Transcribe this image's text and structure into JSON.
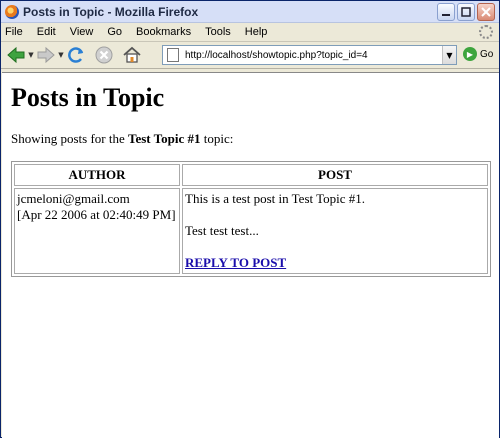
{
  "window": {
    "title": "Posts in Topic - Mozilla Firefox"
  },
  "menubar": {
    "items": [
      "File",
      "Edit",
      "View",
      "Go",
      "Bookmarks",
      "Tools",
      "Help"
    ]
  },
  "navbar": {
    "url": "http://localhost/showtopic.php?topic_id=4",
    "go_label": "Go"
  },
  "page": {
    "title": "Posts in Topic",
    "intro_prefix": "Showing posts for the ",
    "topic_name": "Test Topic #1",
    "intro_suffix": " topic:",
    "table": {
      "headers": [
        "AUTHOR",
        "POST"
      ],
      "rows": [
        {
          "author_email": "jcmeloni@gmail.com",
          "author_date": "[Apr 22 2006 at 02:40:49 PM]",
          "post_line1": "This is a test post in Test Topic #1.",
          "post_line2": "Test test test...",
          "reply_label": "REPLY TO POST"
        }
      ]
    }
  }
}
